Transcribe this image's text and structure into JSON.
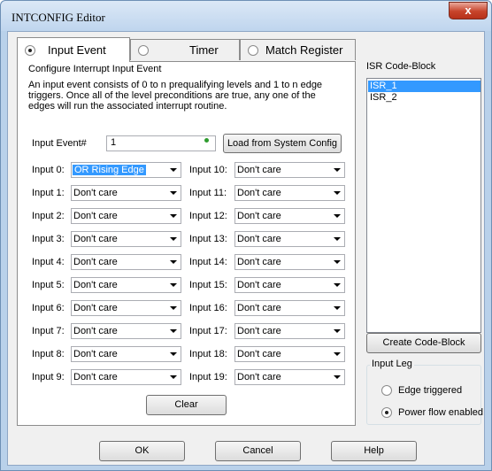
{
  "window": {
    "title": "INTCONFIG Editor",
    "close_glyph": "x"
  },
  "tabs": [
    {
      "label": "Input Event",
      "selected": true
    },
    {
      "label": "Timer",
      "selected": false
    },
    {
      "label": "Match Register",
      "selected": false
    }
  ],
  "panel": {
    "heading": "Configure Interrupt Input Event",
    "description": "An input event consists of 0 to n prequalifying levels and 1 to n edge triggers. Once all of the level preconditions are true, any one of the edges will run the associated interrupt routine.",
    "event_label": "Input Event#",
    "event_value": "1",
    "load_button": "Load from System Config",
    "clear_button": "Clear"
  },
  "inputs_left": [
    {
      "label": "Input 0:",
      "value": "OR Rising Edge"
    },
    {
      "label": "Input 1:",
      "value": "Don't care"
    },
    {
      "label": "Input 2:",
      "value": "Don't care"
    },
    {
      "label": "Input 3:",
      "value": "Don't care"
    },
    {
      "label": "Input 4:",
      "value": "Don't care"
    },
    {
      "label": "Input 5:",
      "value": "Don't care"
    },
    {
      "label": "Input 6:",
      "value": "Don't care"
    },
    {
      "label": "Input 7:",
      "value": "Don't care"
    },
    {
      "label": "Input 8:",
      "value": "Don't care"
    },
    {
      "label": "Input 9:",
      "value": "Don't care"
    }
  ],
  "inputs_right": [
    {
      "label": "Input 10:",
      "value": "Don't care"
    },
    {
      "label": "Input 11:",
      "value": "Don't care"
    },
    {
      "label": "Input 12:",
      "value": "Don't care"
    },
    {
      "label": "Input 13:",
      "value": "Don't care"
    },
    {
      "label": "Input 14:",
      "value": "Don't care"
    },
    {
      "label": "Input 15:",
      "value": "Don't care"
    },
    {
      "label": "Input 16:",
      "value": "Don't care"
    },
    {
      "label": "Input 17:",
      "value": "Don't care"
    },
    {
      "label": "Input 18:",
      "value": "Don't care"
    },
    {
      "label": "Input 19:",
      "value": "Don't care"
    }
  ],
  "isr": {
    "label": "ISR Code-Block",
    "items": [
      {
        "label": "ISR_1",
        "selected": true
      },
      {
        "label": "ISR_2",
        "selected": false
      }
    ],
    "create_button": "Create Code-Block"
  },
  "input_leg": {
    "label": "Input Leg",
    "options": [
      {
        "label": "Edge triggered",
        "selected": false
      },
      {
        "label": "Power flow enabled",
        "selected": true
      }
    ]
  },
  "footer": {
    "ok": "OK",
    "cancel": "Cancel",
    "help": "Help"
  },
  "colors": {
    "title_bar": "#c4d8ef",
    "close_button": "#c7432a",
    "selection": "#3399ff",
    "status_dot": "#2e9b2e"
  }
}
